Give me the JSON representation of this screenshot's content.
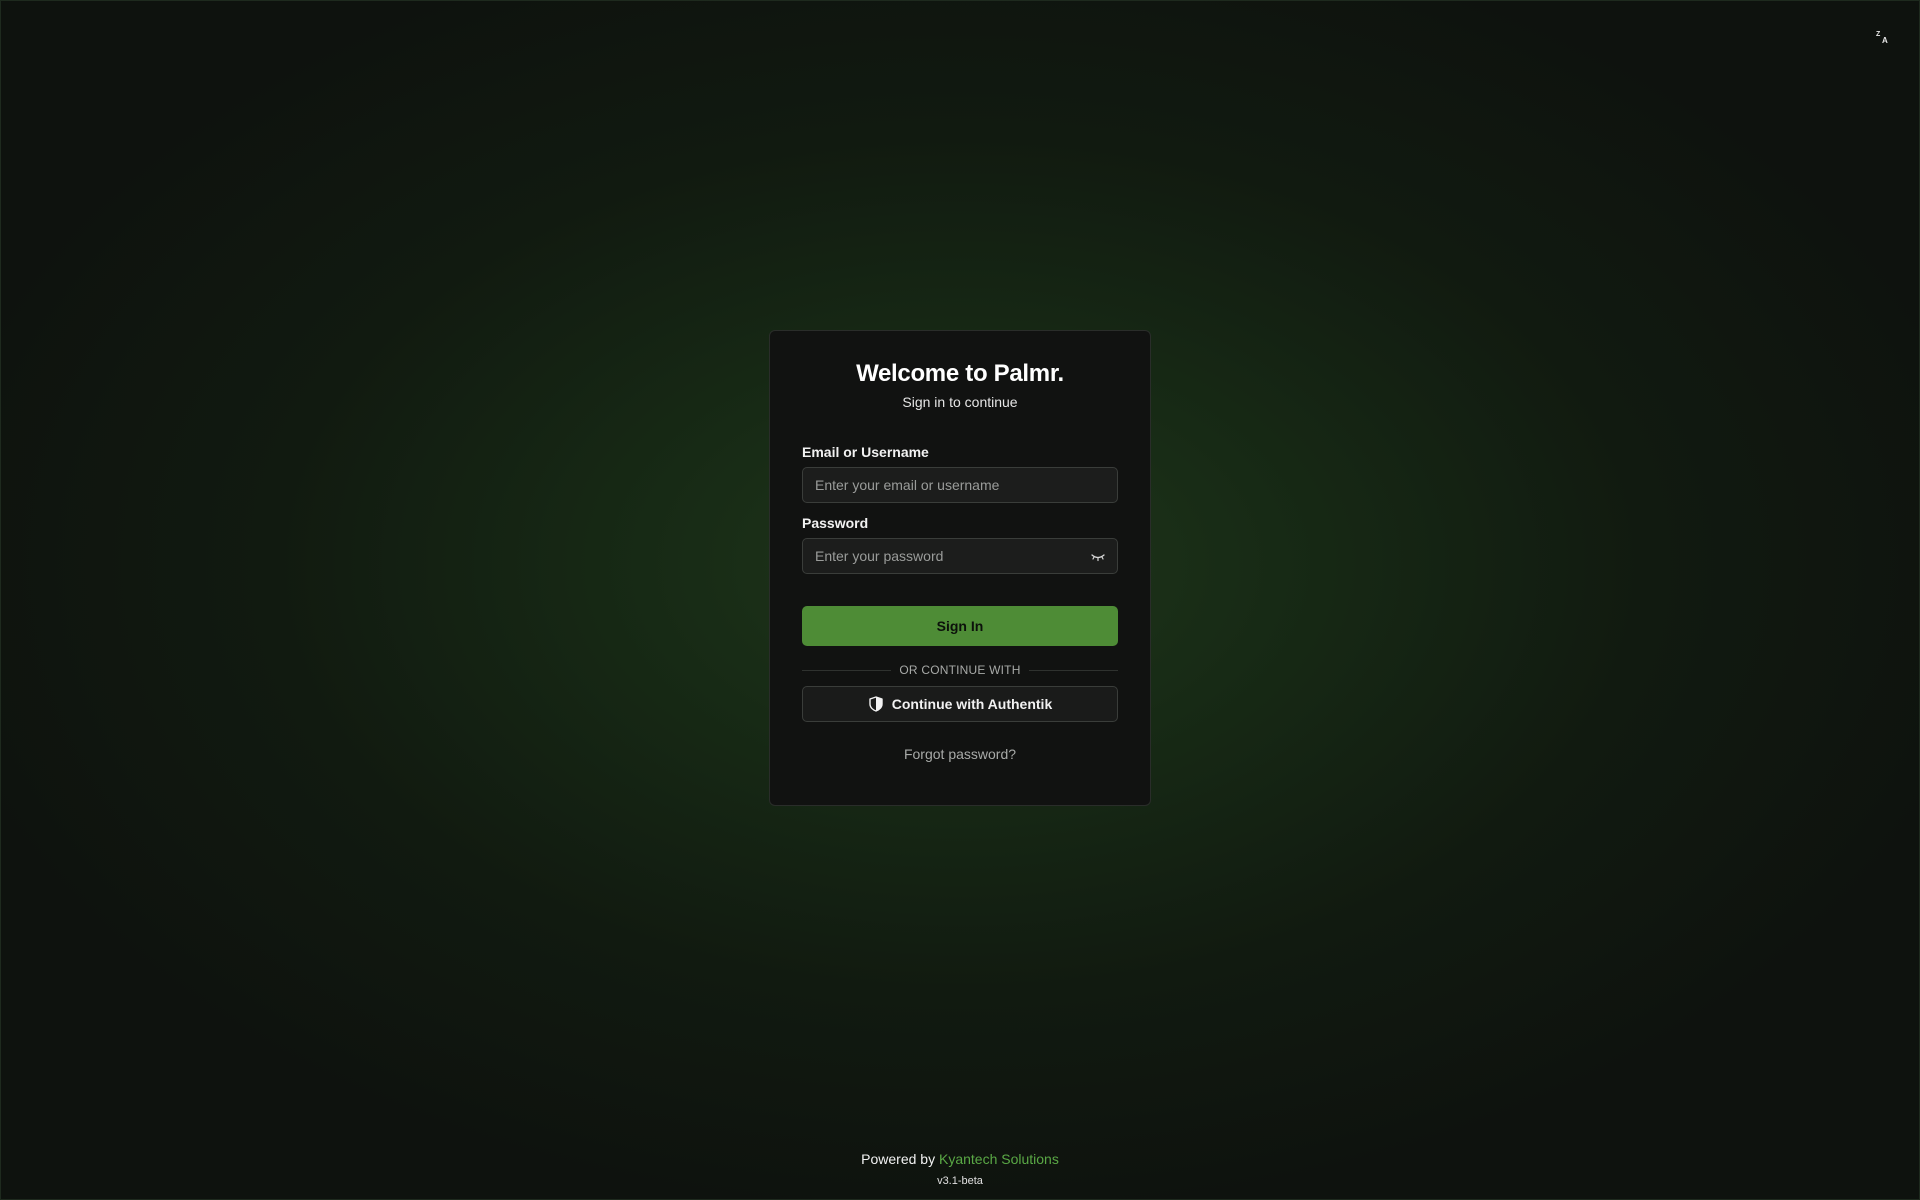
{
  "header": {
    "language_icon": "translate-icon"
  },
  "login": {
    "title": "Welcome to Palmr.",
    "subtitle": "Sign in to continue",
    "email_label": "Email or Username",
    "email_placeholder": "Enter your email or username",
    "email_value": "",
    "password_label": "Password",
    "password_placeholder": "Enter your password",
    "password_value": "",
    "password_toggle_icon": "eye-off-icon",
    "signin_label": "Sign In",
    "divider_text": "OR CONTINUE WITH",
    "oauth_label": "Continue with Authentik",
    "oauth_icon": "shield-icon",
    "forgot_label": "Forgot password?"
  },
  "footer": {
    "powered_by": "Powered by",
    "company": "Kyantech Solutions",
    "version": "v3.1-beta"
  },
  "colors": {
    "accent": "#4e8c36",
    "link": "#5aa845",
    "card_bg": "#111211",
    "page_bg": "#0e120e"
  }
}
